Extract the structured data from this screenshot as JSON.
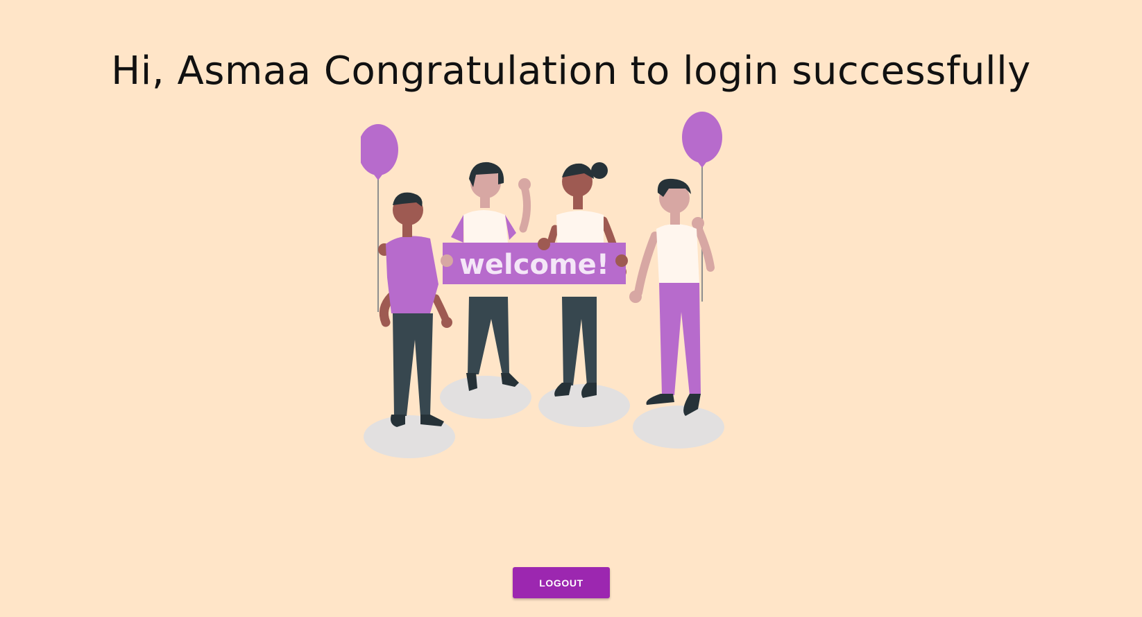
{
  "greeting": {
    "text": "Hi, Asmaa Congratulation to login successfully"
  },
  "illustration": {
    "sign_text": "welcome!",
    "colors": {
      "accent": "#B76BCC",
      "shadow": "#E2E0E0",
      "pants": "#37474F"
    }
  },
  "logout": {
    "label": "LOGOUT",
    "color": "#9C27B0"
  }
}
